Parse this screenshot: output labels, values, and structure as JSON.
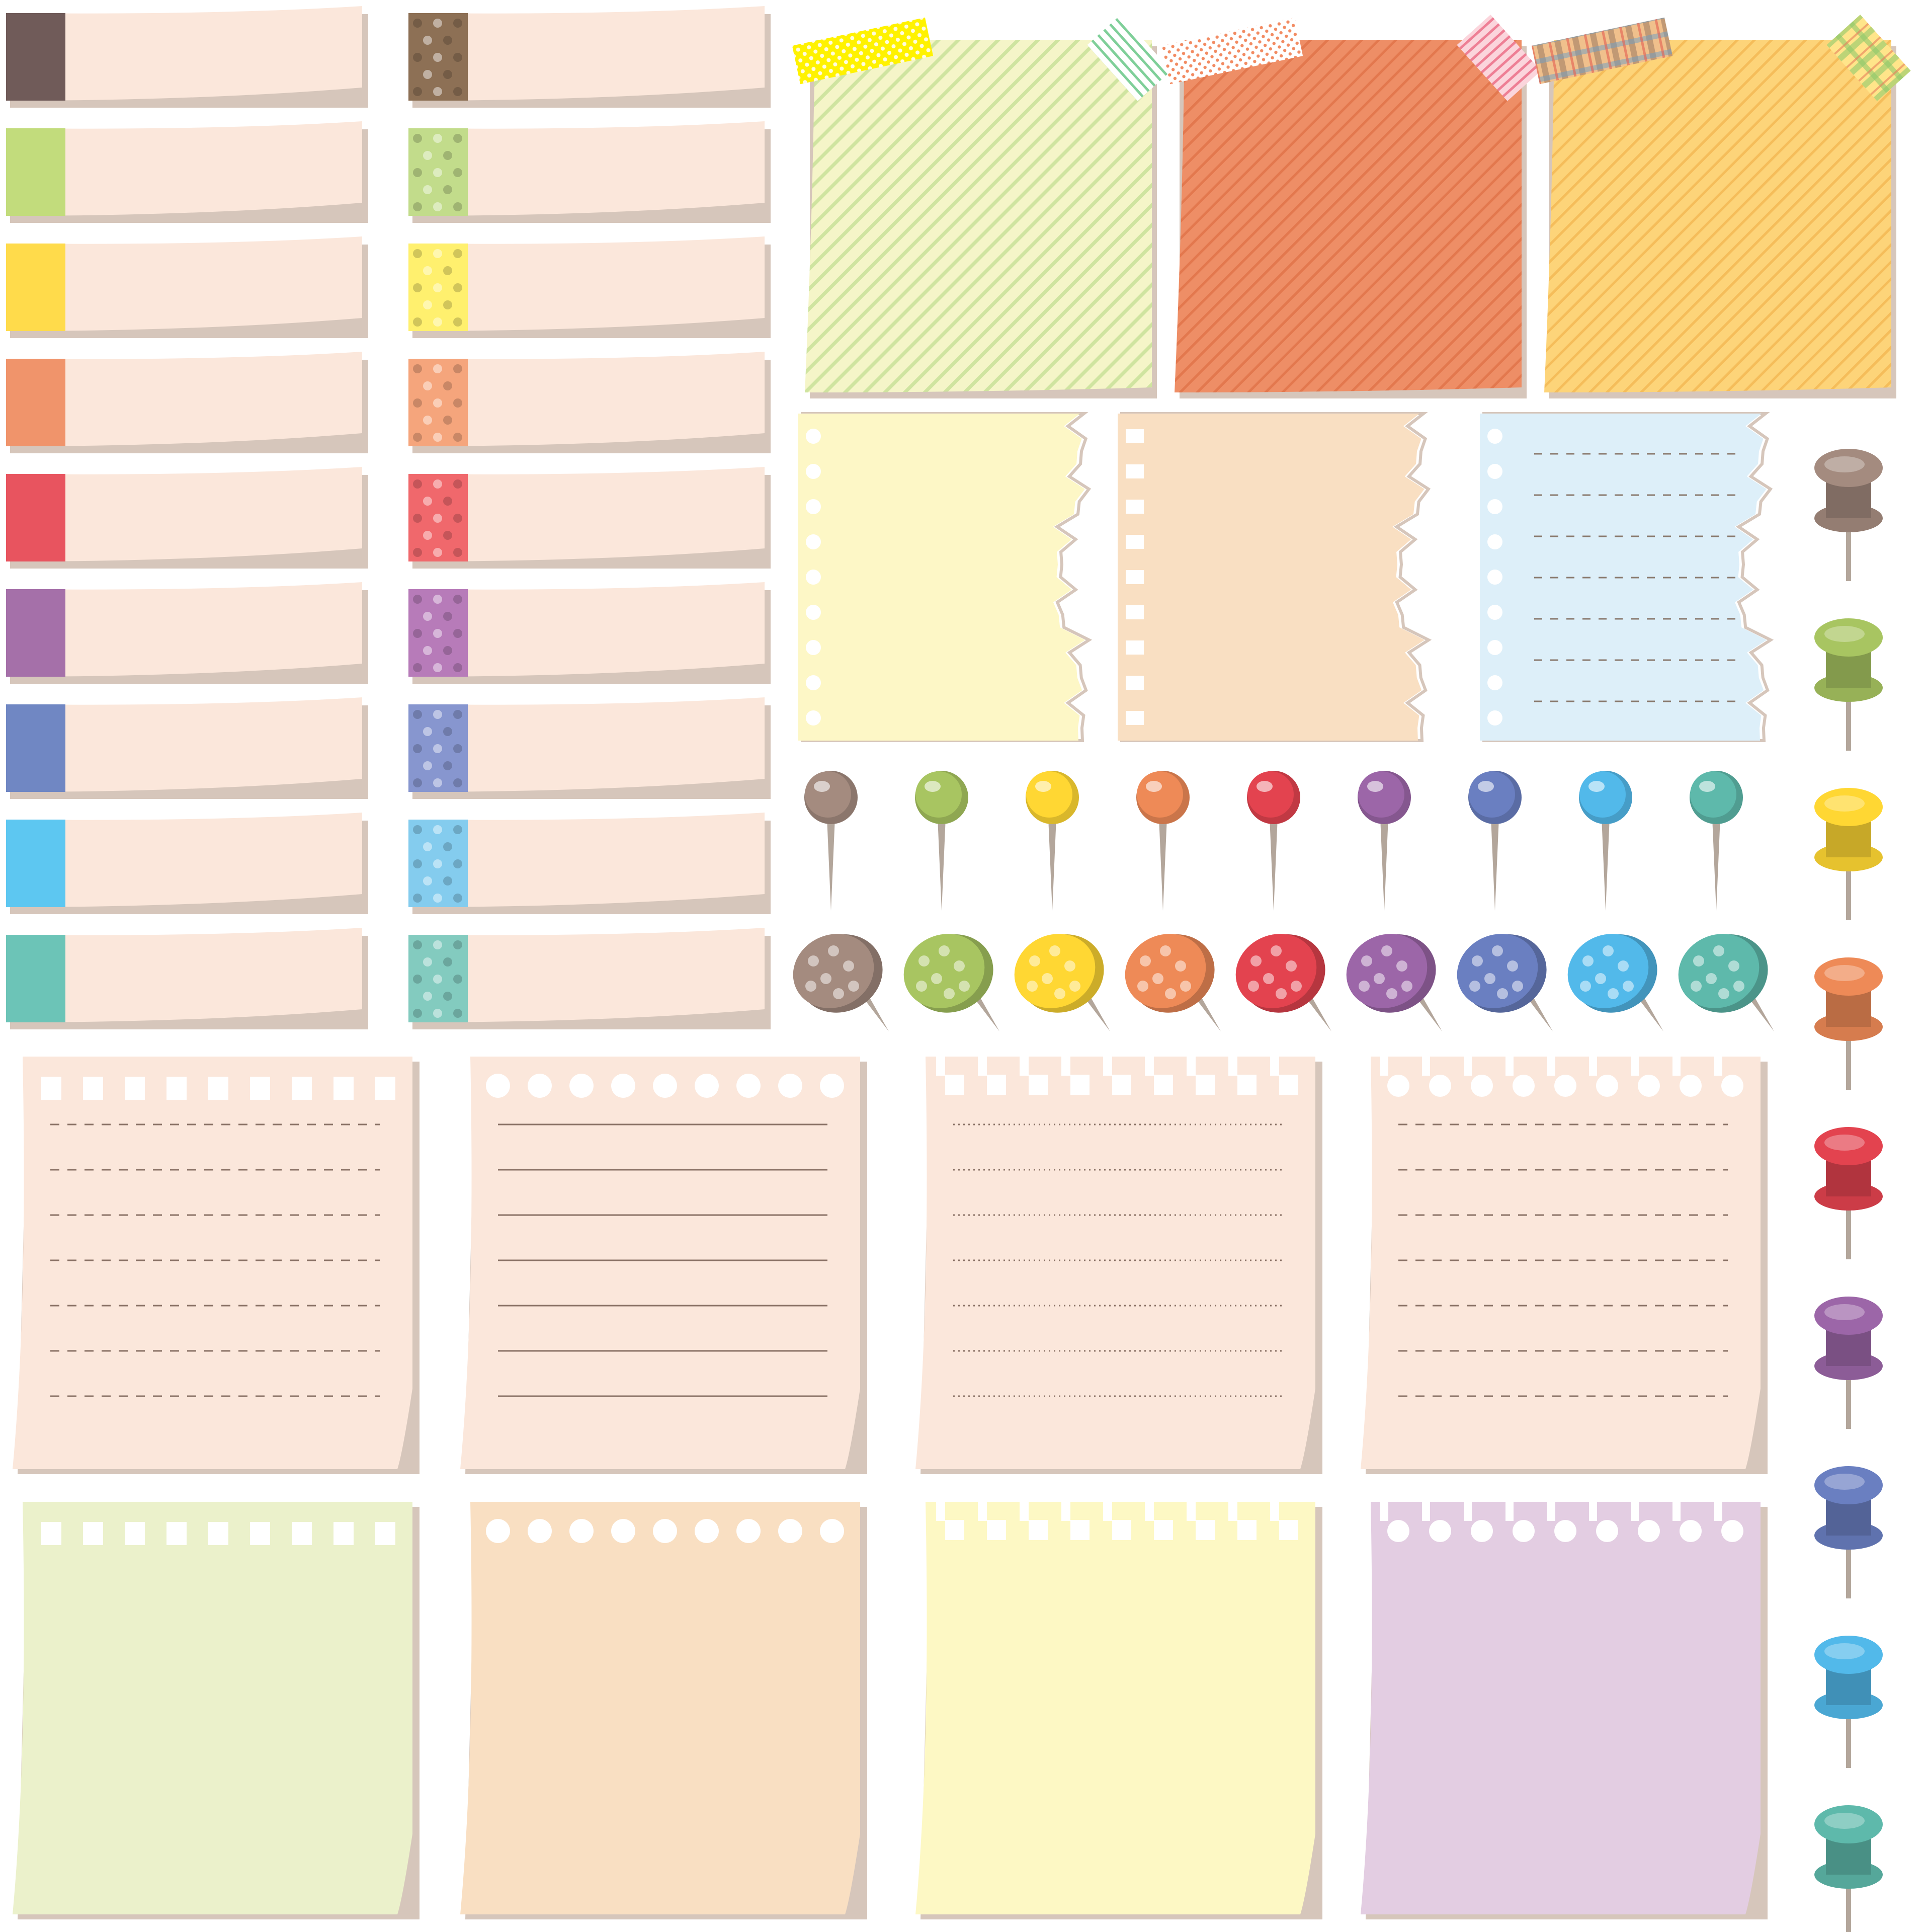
{
  "title": "",
  "colors": {
    "background": "#ffffff",
    "paper": "#fbe7db",
    "paper_shadow": "#d6c6bb",
    "pin_needle": "#b3a69b",
    "tab_solid": [
      "#705b59",
      "#c2dc7c",
      "#ffdb4b",
      "#f0946b",
      "#e8545f",
      "#a570a9",
      "#7087c3",
      "#5dc7f1",
      "#6cc4b7"
    ],
    "tab_dotted": [
      "#8d7055",
      "#c2dc8b",
      "#fff06e",
      "#f5a57c",
      "#f0686c",
      "#b77bb9",
      "#8796cf",
      "#84ccee",
      "#83cbbf"
    ],
    "pin_round": [
      "#a48b7f",
      "#a8c561",
      "#ffd733",
      "#ee8a57",
      "#e3434f",
      "#9c66a8",
      "#6a7fc1",
      "#52b9ea",
      "#5eb9ab"
    ],
    "pin_flat": [
      "#a48b7f",
      "#a8c561",
      "#ffd733",
      "#ee8a57",
      "#e3434f",
      "#9c66a8",
      "#6a7fc1",
      "#52b9ea",
      "#5eb9ab"
    ],
    "push_pin": [
      "#a48b7f",
      "#a8c561",
      "#ffd733",
      "#ee8a57",
      "#e3434f",
      "#9c66a8",
      "#6a7fc1",
      "#52b9ea",
      "#5eb9ab"
    ],
    "sticky_notes": [
      "#f5f5c8",
      "#ee8e66",
      "#fdd479"
    ],
    "sticky_stripes": [
      "#cfe4a0",
      "#e3784e",
      "#f5bd5a"
    ],
    "torn_notes": [
      "#fdf7c6",
      "#f9dfc2",
      "#ddeff9"
    ],
    "memo_lined": "#fbe7db",
    "memo_blank": [
      "#ebf1cb",
      "#f9dfc2",
      "#fdf8c4",
      "#e3cde2"
    ]
  },
  "items": {
    "tabs_solid": 9,
    "tabs_dotted": 9,
    "sticky_notes_taped": 3,
    "torn_notebook_sheets": 3,
    "round_pins": 9,
    "dotted_flat_pins": 9,
    "push_pins": 9,
    "lined_memo_pads": 4,
    "blank_memo_pads": 4
  },
  "memo_line_styles": [
    "dashed",
    "solid",
    "dotted",
    "dashed"
  ],
  "memo_binding_styles": [
    "square-holes",
    "round-holes",
    "square-tabs",
    "round-tabs"
  ],
  "tape_patterns": [
    [
      "dots-yellow",
      "stripes-green"
    ],
    [
      "dots-orange",
      "stripes-pink"
    ],
    [
      "plaid-brown",
      "plaid-green"
    ]
  ]
}
